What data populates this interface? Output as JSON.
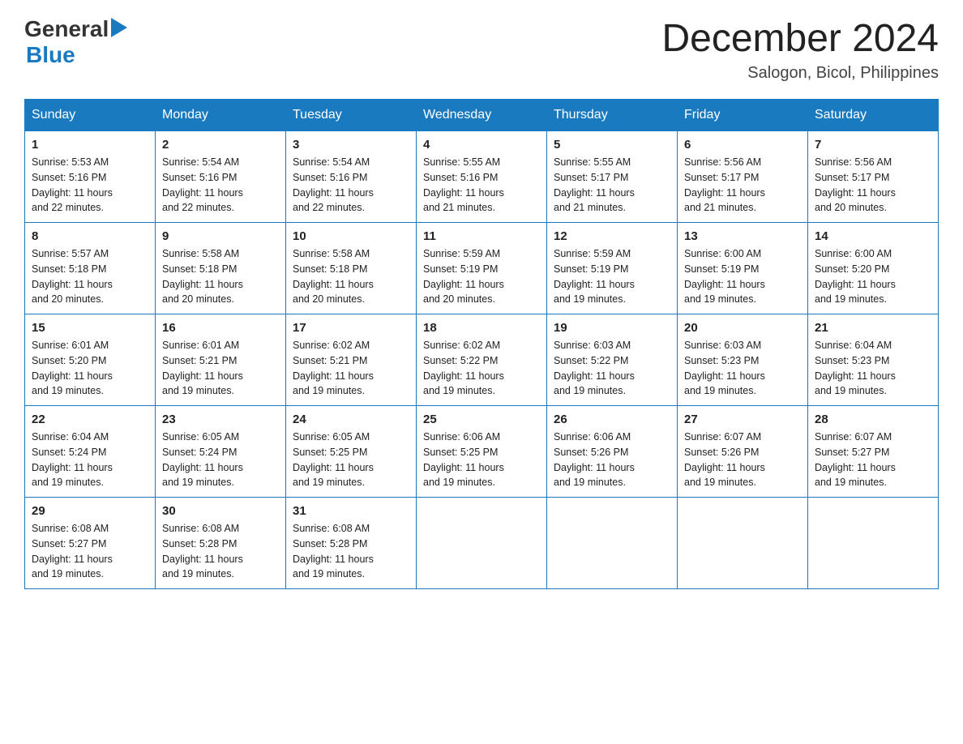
{
  "header": {
    "logo_general": "General",
    "logo_blue": "Blue",
    "month_year": "December 2024",
    "location": "Salogon, Bicol, Philippines"
  },
  "days_of_week": [
    "Sunday",
    "Monday",
    "Tuesday",
    "Wednesday",
    "Thursday",
    "Friday",
    "Saturday"
  ],
  "weeks": [
    [
      {
        "day": "1",
        "sunrise": "5:53 AM",
        "sunset": "5:16 PM",
        "daylight": "11 hours and 22 minutes."
      },
      {
        "day": "2",
        "sunrise": "5:54 AM",
        "sunset": "5:16 PM",
        "daylight": "11 hours and 22 minutes."
      },
      {
        "day": "3",
        "sunrise": "5:54 AM",
        "sunset": "5:16 PM",
        "daylight": "11 hours and 22 minutes."
      },
      {
        "day": "4",
        "sunrise": "5:55 AM",
        "sunset": "5:16 PM",
        "daylight": "11 hours and 21 minutes."
      },
      {
        "day": "5",
        "sunrise": "5:55 AM",
        "sunset": "5:17 PM",
        "daylight": "11 hours and 21 minutes."
      },
      {
        "day": "6",
        "sunrise": "5:56 AM",
        "sunset": "5:17 PM",
        "daylight": "11 hours and 21 minutes."
      },
      {
        "day": "7",
        "sunrise": "5:56 AM",
        "sunset": "5:17 PM",
        "daylight": "11 hours and 20 minutes."
      }
    ],
    [
      {
        "day": "8",
        "sunrise": "5:57 AM",
        "sunset": "5:18 PM",
        "daylight": "11 hours and 20 minutes."
      },
      {
        "day": "9",
        "sunrise": "5:58 AM",
        "sunset": "5:18 PM",
        "daylight": "11 hours and 20 minutes."
      },
      {
        "day": "10",
        "sunrise": "5:58 AM",
        "sunset": "5:18 PM",
        "daylight": "11 hours and 20 minutes."
      },
      {
        "day": "11",
        "sunrise": "5:59 AM",
        "sunset": "5:19 PM",
        "daylight": "11 hours and 20 minutes."
      },
      {
        "day": "12",
        "sunrise": "5:59 AM",
        "sunset": "5:19 PM",
        "daylight": "11 hours and 19 minutes."
      },
      {
        "day": "13",
        "sunrise": "6:00 AM",
        "sunset": "5:19 PM",
        "daylight": "11 hours and 19 minutes."
      },
      {
        "day": "14",
        "sunrise": "6:00 AM",
        "sunset": "5:20 PM",
        "daylight": "11 hours and 19 minutes."
      }
    ],
    [
      {
        "day": "15",
        "sunrise": "6:01 AM",
        "sunset": "5:20 PM",
        "daylight": "11 hours and 19 minutes."
      },
      {
        "day": "16",
        "sunrise": "6:01 AM",
        "sunset": "5:21 PM",
        "daylight": "11 hours and 19 minutes."
      },
      {
        "day": "17",
        "sunrise": "6:02 AM",
        "sunset": "5:21 PM",
        "daylight": "11 hours and 19 minutes."
      },
      {
        "day": "18",
        "sunrise": "6:02 AM",
        "sunset": "5:22 PM",
        "daylight": "11 hours and 19 minutes."
      },
      {
        "day": "19",
        "sunrise": "6:03 AM",
        "sunset": "5:22 PM",
        "daylight": "11 hours and 19 minutes."
      },
      {
        "day": "20",
        "sunrise": "6:03 AM",
        "sunset": "5:23 PM",
        "daylight": "11 hours and 19 minutes."
      },
      {
        "day": "21",
        "sunrise": "6:04 AM",
        "sunset": "5:23 PM",
        "daylight": "11 hours and 19 minutes."
      }
    ],
    [
      {
        "day": "22",
        "sunrise": "6:04 AM",
        "sunset": "5:24 PM",
        "daylight": "11 hours and 19 minutes."
      },
      {
        "day": "23",
        "sunrise": "6:05 AM",
        "sunset": "5:24 PM",
        "daylight": "11 hours and 19 minutes."
      },
      {
        "day": "24",
        "sunrise": "6:05 AM",
        "sunset": "5:25 PM",
        "daylight": "11 hours and 19 minutes."
      },
      {
        "day": "25",
        "sunrise": "6:06 AM",
        "sunset": "5:25 PM",
        "daylight": "11 hours and 19 minutes."
      },
      {
        "day": "26",
        "sunrise": "6:06 AM",
        "sunset": "5:26 PM",
        "daylight": "11 hours and 19 minutes."
      },
      {
        "day": "27",
        "sunrise": "6:07 AM",
        "sunset": "5:26 PM",
        "daylight": "11 hours and 19 minutes."
      },
      {
        "day": "28",
        "sunrise": "6:07 AM",
        "sunset": "5:27 PM",
        "daylight": "11 hours and 19 minutes."
      }
    ],
    [
      {
        "day": "29",
        "sunrise": "6:08 AM",
        "sunset": "5:27 PM",
        "daylight": "11 hours and 19 minutes."
      },
      {
        "day": "30",
        "sunrise": "6:08 AM",
        "sunset": "5:28 PM",
        "daylight": "11 hours and 19 minutes."
      },
      {
        "day": "31",
        "sunrise": "6:08 AM",
        "sunset": "5:28 PM",
        "daylight": "11 hours and 19 minutes."
      },
      null,
      null,
      null,
      null
    ]
  ],
  "labels": {
    "sunrise": "Sunrise:",
    "sunset": "Sunset:",
    "daylight": "Daylight:"
  }
}
